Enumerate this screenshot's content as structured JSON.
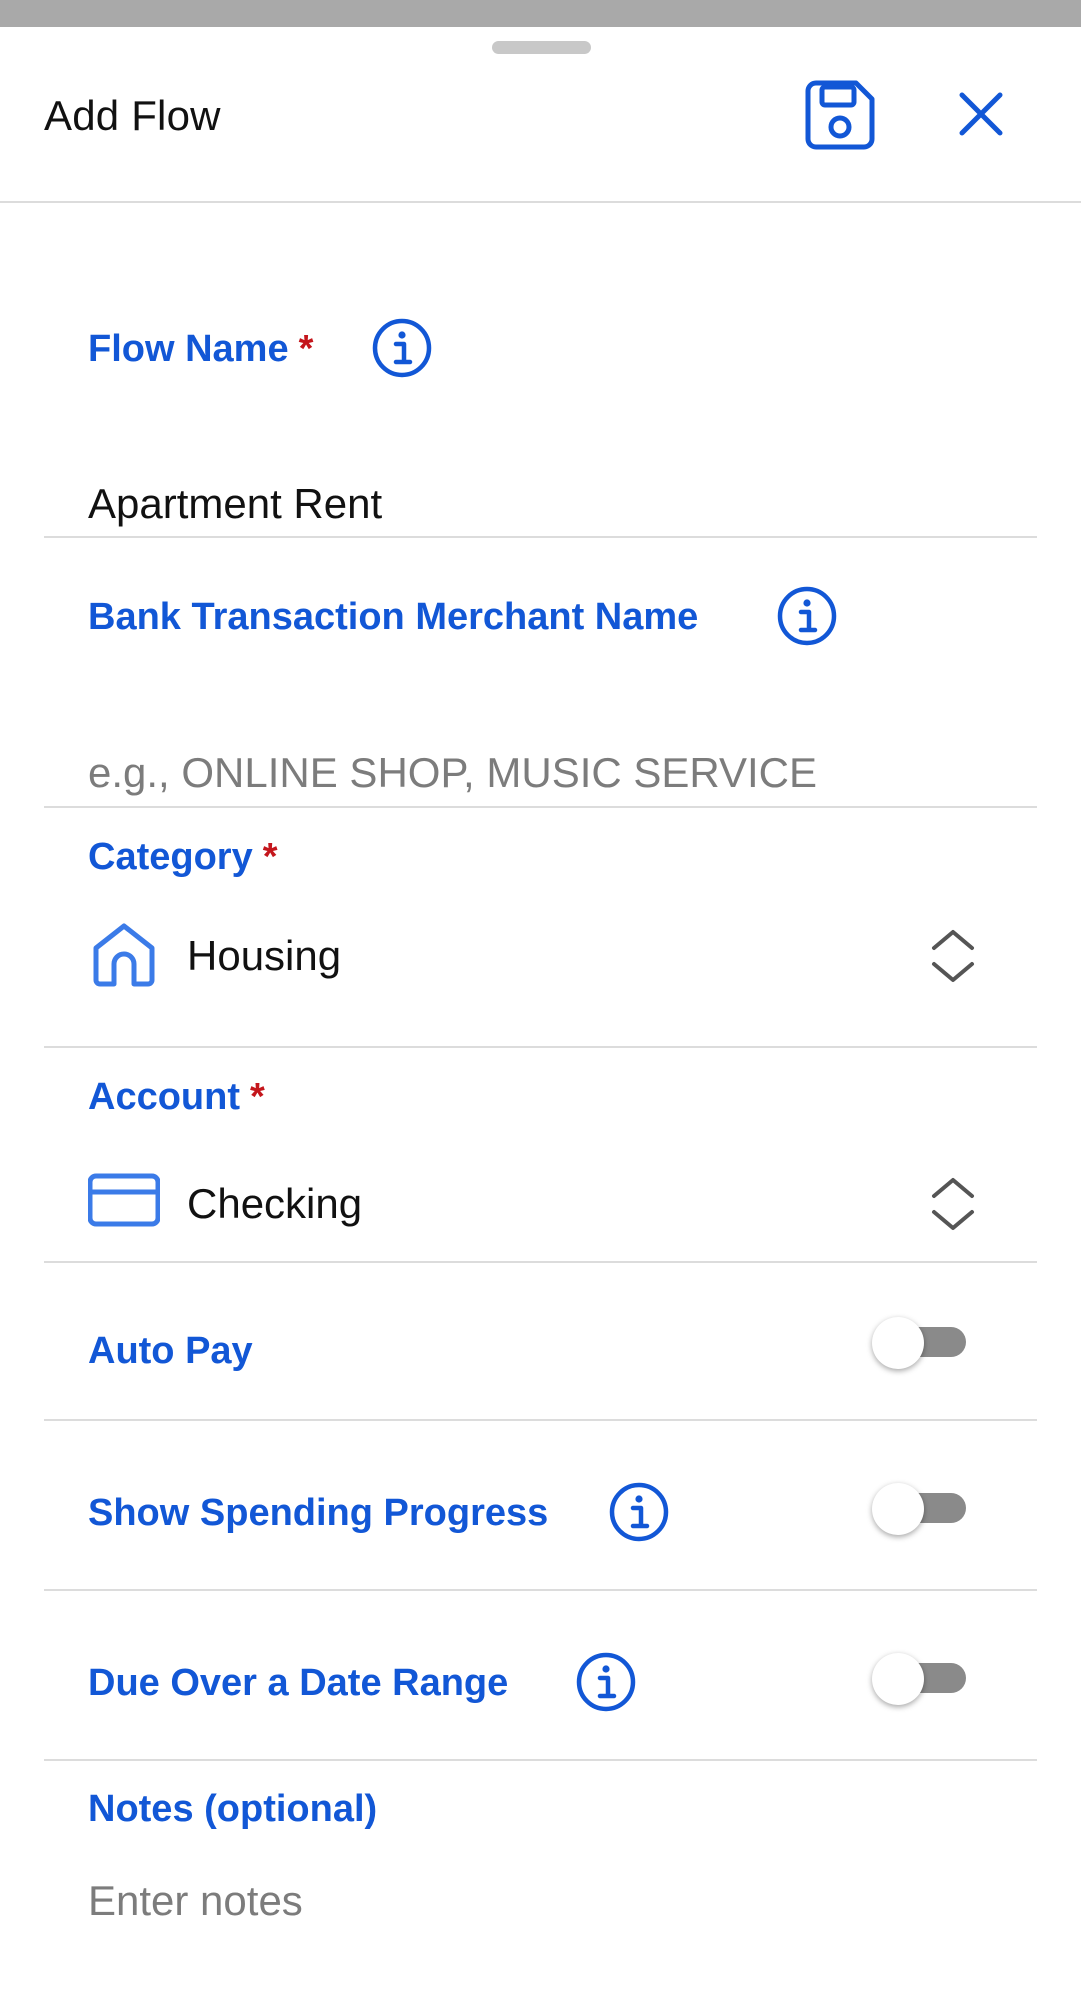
{
  "header": {
    "title": "Add Flow",
    "save_icon": "save-icon",
    "close_icon": "close-icon"
  },
  "form": {
    "flow_name": {
      "label": "Flow Name",
      "required_mark": "*",
      "value": "Apartment Rent"
    },
    "merchant_name": {
      "label": "Bank Transaction Merchant Name",
      "value": "",
      "placeholder": "e.g., ONLINE SHOP, MUSIC SERVICE"
    },
    "category": {
      "label": "Category",
      "required_mark": "*",
      "value": "Housing",
      "icon": "house-icon"
    },
    "account": {
      "label": "Account",
      "required_mark": "*",
      "value": "Checking",
      "icon": "credit-card-icon"
    },
    "auto_pay": {
      "label": "Auto Pay",
      "enabled": false
    },
    "show_spending_progress": {
      "label": "Show Spending Progress",
      "enabled": false
    },
    "due_over_date_range": {
      "label": "Due Over a Date Range",
      "enabled": false
    },
    "notes": {
      "label": "Notes (optional)",
      "value": "",
      "placeholder": "Enter notes"
    }
  },
  "colors": {
    "accent": "#1257d6",
    "required": "#c4161c",
    "icon_blue": "#3b7be8",
    "toggle_off": "#8a8a8a"
  }
}
